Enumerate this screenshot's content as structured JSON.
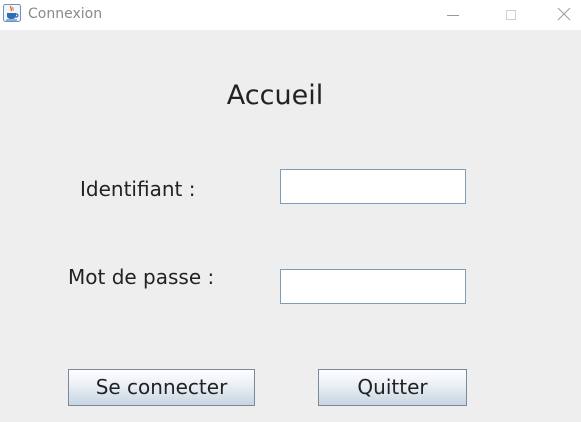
{
  "window": {
    "title": "Connexion",
    "icon": "java-cup-icon",
    "controls": {
      "minimize_icon": "minimize-icon",
      "maximize_icon": "maximize-icon",
      "close_icon": "close-icon"
    }
  },
  "form": {
    "heading": "Accueil",
    "username_label": "Identifiant :",
    "username_value": "",
    "password_label": "Mot de passe :",
    "password_value": ""
  },
  "actions": {
    "connect_label": "Se connecter",
    "quit_label": "Quitter"
  },
  "colors": {
    "background": "#eeeeee",
    "titlebar": "#ffffff",
    "field_border": "#7f9db9",
    "button_gradient_bottom": "#c7d5e2"
  }
}
